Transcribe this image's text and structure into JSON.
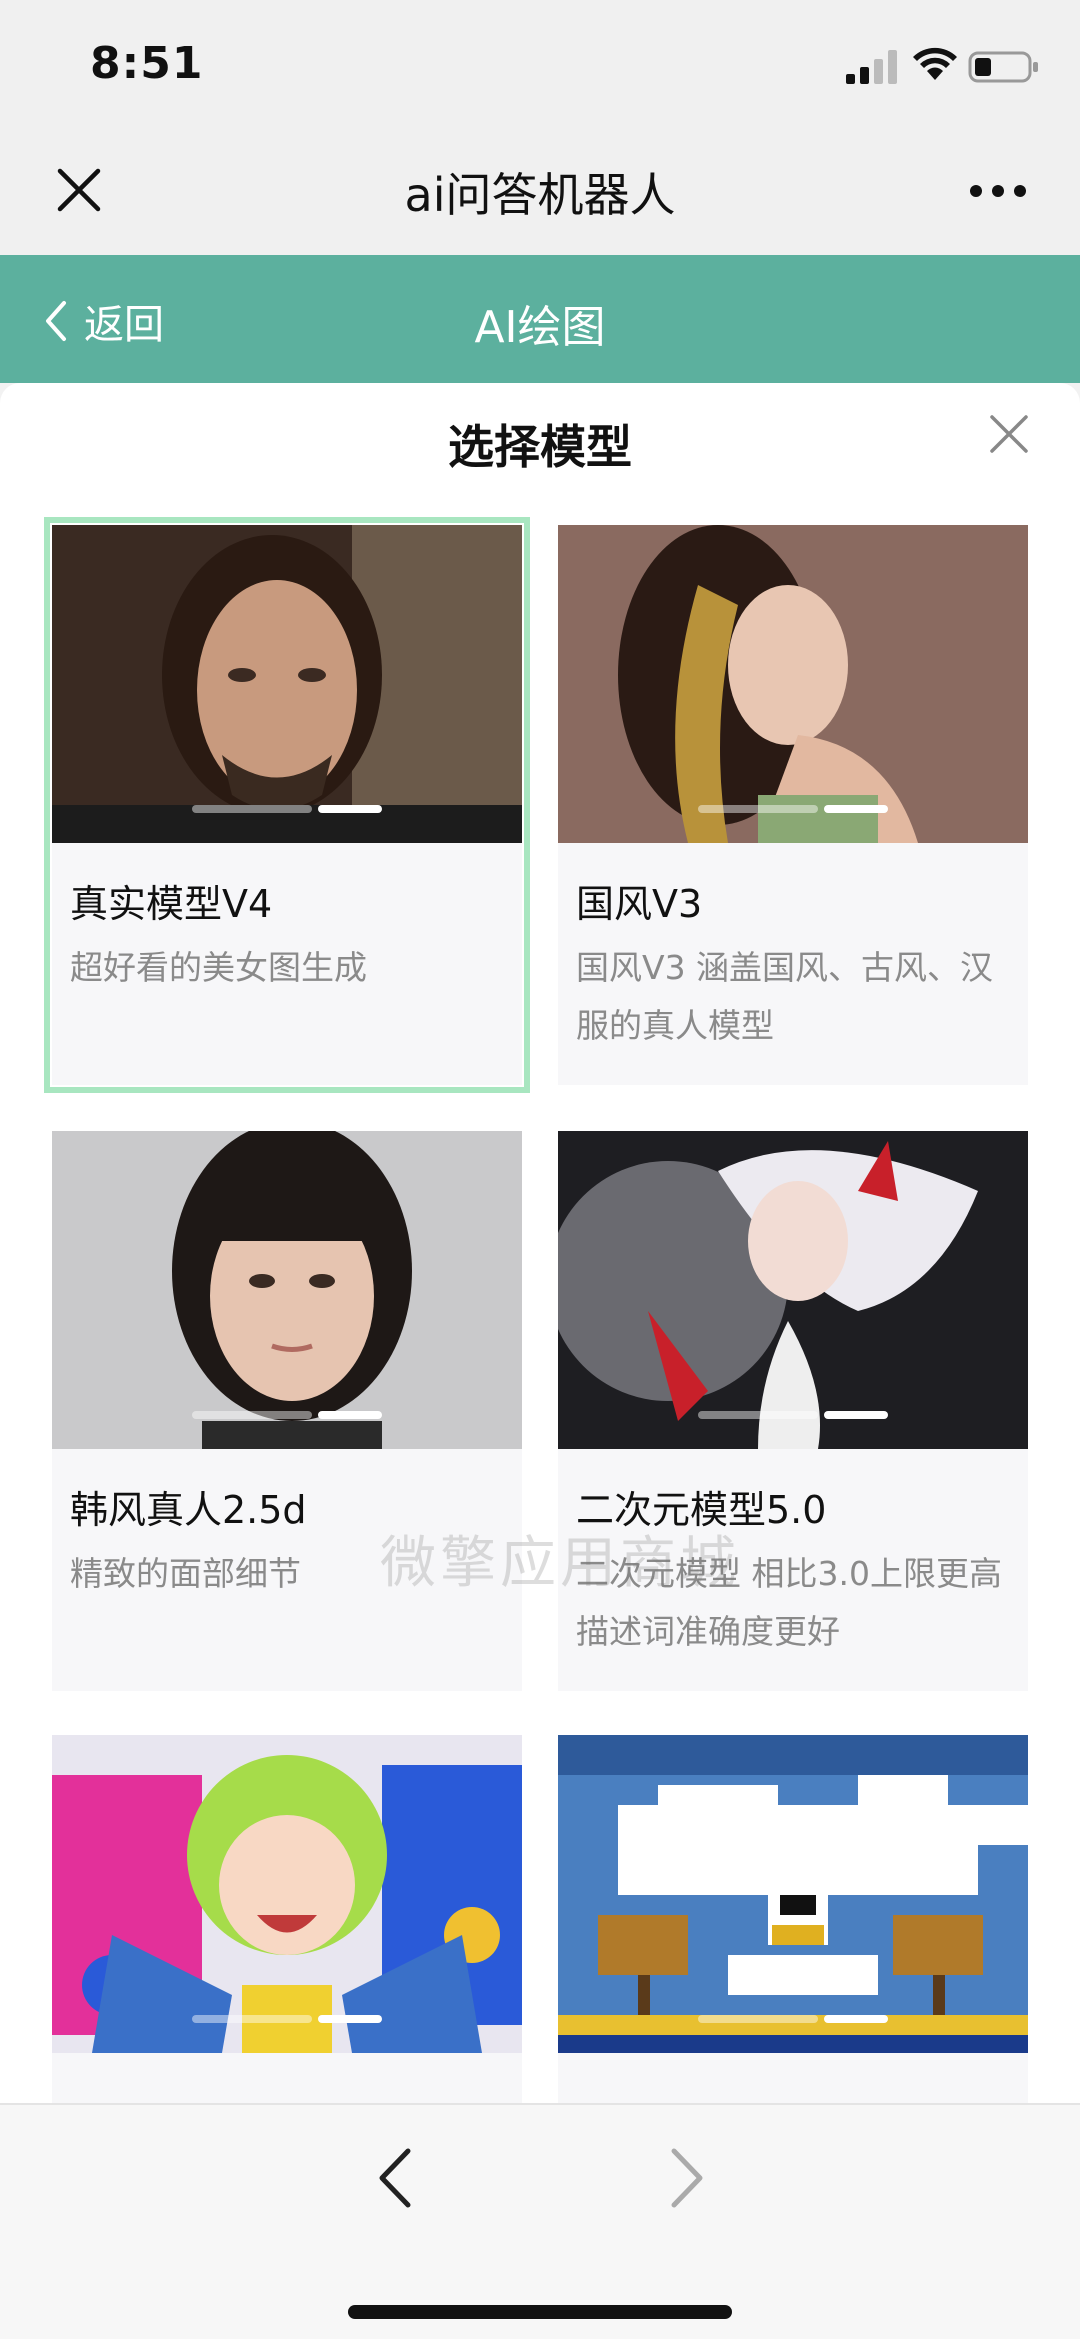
{
  "status_bar": {
    "time": "8:51"
  },
  "wx_nav": {
    "title": "ai问答机器人"
  },
  "header": {
    "back_label": "返回",
    "title": "AI绘图"
  },
  "sheet": {
    "title": "选择模型",
    "watermark": "微擎应用商城",
    "models": [
      {
        "name": "真实模型V4",
        "desc": "超好看的美女图生成",
        "selected": true
      },
      {
        "name": "国风V3",
        "desc": "国风V3 涵盖国风、古风、汉服的真人模型",
        "selected": false
      },
      {
        "name": "韩风真人2.5d",
        "desc": "精致的面部细节",
        "selected": false
      },
      {
        "name": "二次元模型5.0",
        "desc": "二次元模型 相比3.0上限更高 描述词准确度更好",
        "selected": false
      },
      {
        "name": "",
        "desc": "",
        "selected": false
      },
      {
        "name": "",
        "desc": "",
        "selected": false
      }
    ]
  },
  "colors": {
    "header_green": "#5cb09e",
    "selected_border": "#a8e6c0"
  }
}
